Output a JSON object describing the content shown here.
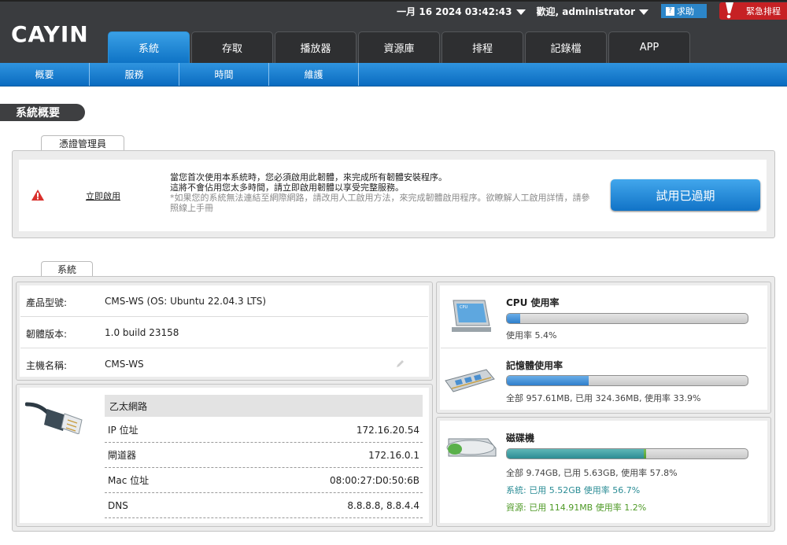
{
  "header": {
    "datetime": "一月 16 2024 03:42:43",
    "welcome": "歡迎, administrator",
    "help_label": "求助",
    "urgent_label": "緊急排程",
    "tabs": [
      "系統",
      "存取",
      "播放器",
      "資源庫",
      "排程",
      "記錄檔",
      "APP"
    ],
    "active_tab": 0
  },
  "subnav": [
    "概要",
    "服務",
    "時間",
    "維護"
  ],
  "page_title": "系統概要",
  "license": {
    "section_label": "憑證管理員",
    "activate_link": "立即啟用",
    "line1": "當您首次使用本系統時，您必須啟用此韌體，來完成所有韌體安裝程序。",
    "line2": "這將不會佔用您太多時間，請立即啟用韌體以享受完整服務。",
    "note": "*如果您的系統無法連結至網際網路，請改用人工啟用方法，來完成韌體啟用程序。欲瞭解人工啟用詳情，請參照線上手冊",
    "trial_button": "試用已過期"
  },
  "system": {
    "section_label": "系統",
    "model_label": "產品型號:",
    "model_value": "CMS-WS (OS: Ubuntu 22.04.3 LTS)",
    "firmware_label": "韌體版本:",
    "firmware_value": "1.0 build 23158",
    "hostname_label": "主機名稱:",
    "hostname_value": "CMS-WS"
  },
  "network": {
    "header": "乙太網路",
    "rows": [
      {
        "label": "IP 位址",
        "value": "172.16.20.54"
      },
      {
        "label": "閘道器",
        "value": "172.16.0.1"
      },
      {
        "label": "Mac 位址",
        "value": "08:00:27:D0:50:6B"
      },
      {
        "label": "DNS",
        "value": "8.8.8.8, 8.8.4.4"
      }
    ]
  },
  "cpu": {
    "title": "CPU 使用率",
    "usage": "使用率 5.4%",
    "percent": 5.4,
    "chip_label": "CPU"
  },
  "memory": {
    "title": "記憶體使用率",
    "usage": "全部 957.61MB, 已用 324.36MB, 使用率 33.9%",
    "percent": 33.9
  },
  "disk": {
    "title": "磁碟機",
    "usage": "全部 9.74GB, 已用 5.63GB, 使用率 57.8%",
    "system": "系統: 已用 5.52GB 使用率 56.7%",
    "resource": "資源: 已用 114.91MB 使用率 1.2%",
    "system_percent": 56.7,
    "resource_percent": 1.2
  }
}
